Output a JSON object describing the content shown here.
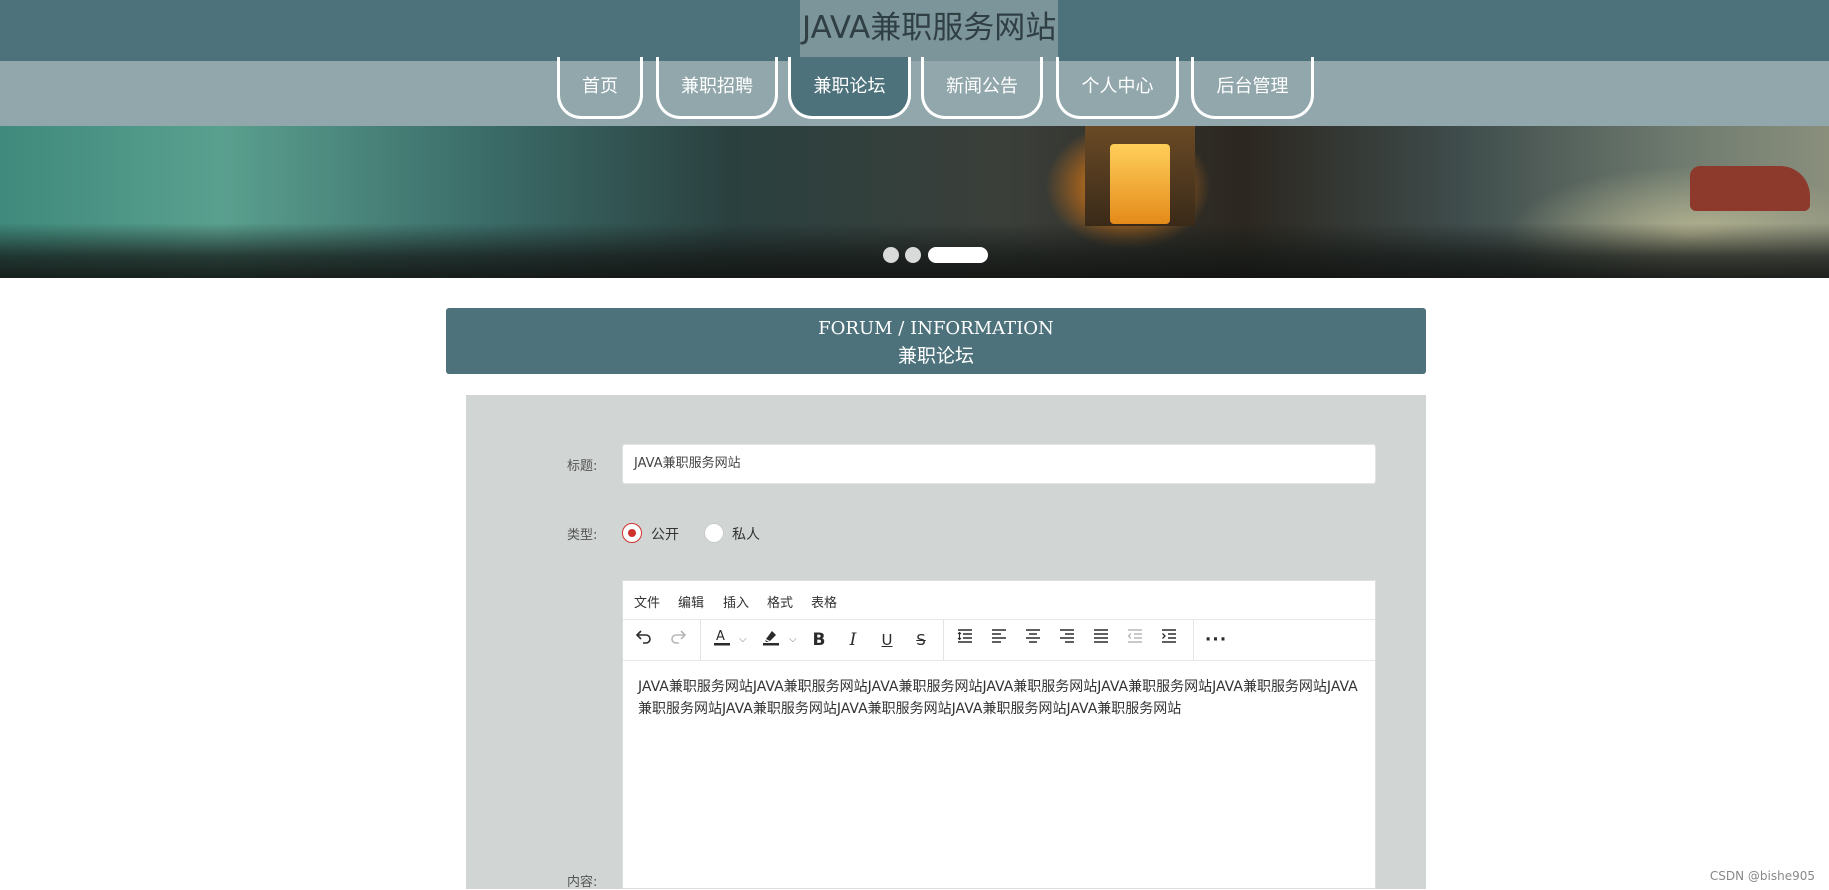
{
  "site": {
    "title": "JAVA兼职服务网站"
  },
  "nav": {
    "items": [
      {
        "label": "首页"
      },
      {
        "label": "兼职招聘"
      },
      {
        "label": "兼职论坛"
      },
      {
        "label": "新闻公告"
      },
      {
        "label": "个人中心"
      },
      {
        "label": "后台管理"
      }
    ],
    "active_index": 2
  },
  "banner": {
    "slide_count": 3,
    "active_slide": 3
  },
  "section": {
    "title_en": "FORUM / INFORMATION",
    "title_zh": "兼职论坛"
  },
  "form": {
    "title_label": "标题:",
    "title_value": "JAVA兼职服务网站",
    "type_label": "类型:",
    "type_options": [
      "公开",
      "私人"
    ],
    "type_selected": "公开",
    "content_label": "内容:"
  },
  "editor": {
    "menus": [
      "文件",
      "编辑",
      "插入",
      "格式",
      "表格"
    ],
    "toolbar_icons": [
      "undo-icon",
      "redo-icon",
      "text-color-icon",
      "highlight-color-icon",
      "bold-icon",
      "italic-icon",
      "underline-icon",
      "strikethrough-icon",
      "line-height-icon",
      "align-left-icon",
      "align-center-icon",
      "align-right-icon",
      "justify-icon",
      "outdent-icon",
      "indent-icon",
      "more-icon"
    ],
    "content": "JAVA兼职服务网站JAVA兼职服务网站JAVA兼职服务网站JAVA兼职服务网站JAVA兼职服务网站JAVA兼职服务网站JAVA兼职服务网站JAVA兼职服务网站JAVA兼职服务网站JAVA兼职服务网站JAVA兼职服务网站"
  },
  "watermark": "CSDN @bishe905",
  "colors": {
    "primary": "#4d727b",
    "nav_bg": "#91a7ac",
    "panel_bg": "#d1d5d4",
    "radio_active": "#d0312d"
  }
}
